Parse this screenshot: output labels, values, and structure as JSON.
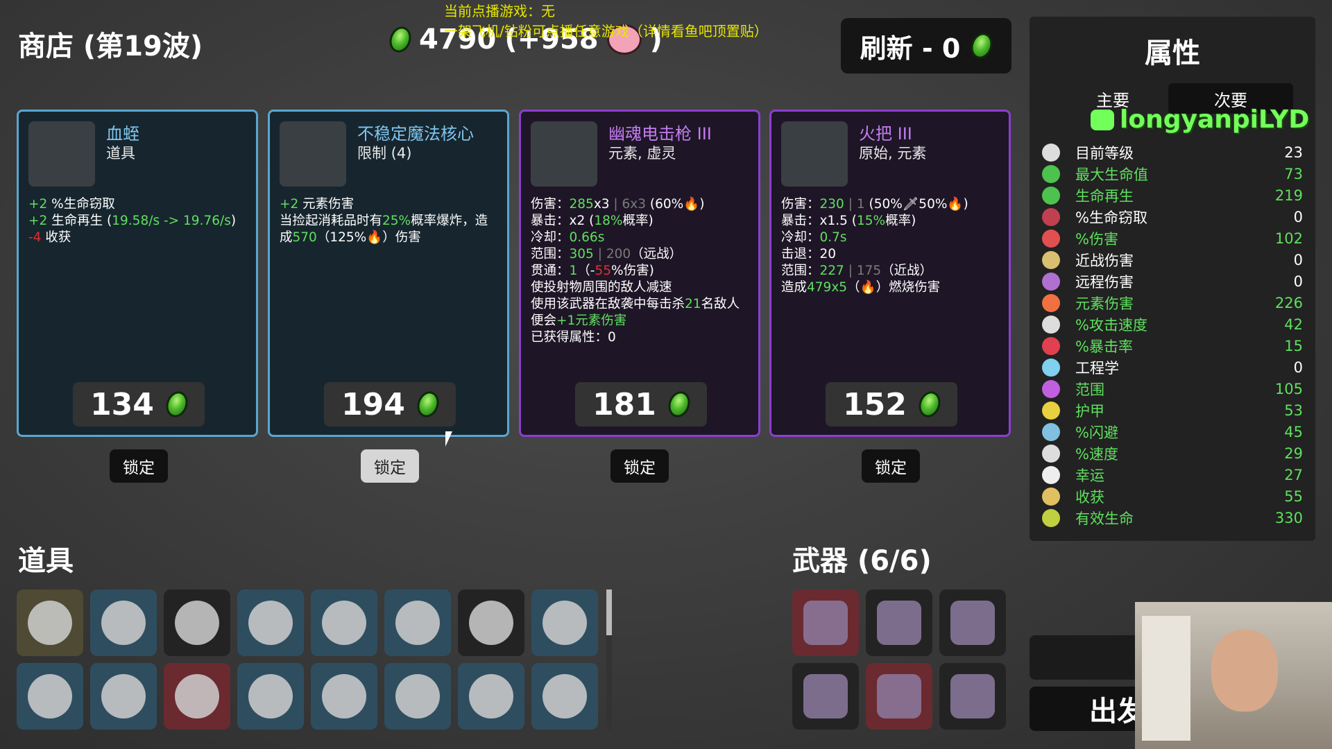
{
  "shop": {
    "title": "商店 (第19波)"
  },
  "money": {
    "amount": "4790",
    "bonus_prefix": "(+958",
    "bonus_suffix": ")"
  },
  "stream_overlay": {
    "line1": "当前点播游戏：无",
    "line2": "一架飞机/钻粉可点播任意游戏（详情看鱼吧顶置贴）"
  },
  "refresh": {
    "label": "刷新 - 0"
  },
  "cards": [
    {
      "name": "血蛭",
      "sub": "道具",
      "price": "134",
      "lock": "锁定",
      "desc_lines": [
        [
          {
            "t": "+2",
            "c": "g"
          },
          {
            "t": " %生命窃取",
            "c": ""
          }
        ],
        [
          {
            "t": "+2",
            "c": "g"
          },
          {
            "t": " 生命再生 (",
            "c": ""
          },
          {
            "t": "19.58/s -> 19.76/s",
            "c": "g"
          },
          {
            "t": ")",
            "c": ""
          }
        ],
        [
          {
            "t": "-4",
            "c": "r"
          },
          {
            "t": " 收获",
            "c": ""
          }
        ]
      ]
    },
    {
      "name": "不稳定魔法核心",
      "sub": "限制 (4)",
      "price": "194",
      "lock": "锁定",
      "desc_lines": [
        [
          {
            "t": "+2",
            "c": "g"
          },
          {
            "t": " 元素伤害",
            "c": ""
          }
        ],
        [
          {
            "t": "当捡起消耗品时有",
            "c": ""
          },
          {
            "t": "25%",
            "c": "g"
          },
          {
            "t": "概率爆炸，造",
            "c": ""
          }
        ],
        [
          {
            "t": "成",
            "c": ""
          },
          {
            "t": "570",
            "c": "g"
          },
          {
            "t": "（125%🔥）伤害",
            "c": ""
          }
        ]
      ]
    },
    {
      "name": "幽魂电击枪 III",
      "sub": "元素, 虚灵",
      "price": "181",
      "lock": "锁定",
      "desc_lines": [
        [
          {
            "t": "伤害：",
            "c": ""
          },
          {
            "t": "285",
            "c": "g"
          },
          {
            "t": "x3",
            "c": ""
          },
          {
            "t": " | 6x3",
            "c": "gr"
          },
          {
            "t": " (60%🔥)",
            "c": ""
          }
        ],
        [
          {
            "t": "暴击：x2 (",
            "c": ""
          },
          {
            "t": "18%",
            "c": "g"
          },
          {
            "t": "概率)",
            "c": ""
          }
        ],
        [
          {
            "t": "冷却：",
            "c": ""
          },
          {
            "t": "0.66s",
            "c": "g"
          }
        ],
        [
          {
            "t": "范围：",
            "c": ""
          },
          {
            "t": "305",
            "c": "g"
          },
          {
            "t": " | 200",
            "c": "gr"
          },
          {
            "t": "（远战）",
            "c": ""
          }
        ],
        [
          {
            "t": "贯通：",
            "c": ""
          },
          {
            "t": "1",
            "c": "g"
          },
          {
            "t": "（-",
            "c": ""
          },
          {
            "t": "55",
            "c": "r"
          },
          {
            "t": "%伤害)",
            "c": ""
          }
        ],
        [
          {
            "t": "使投射物周围的敌人减速",
            "c": ""
          }
        ],
        [
          {
            "t": "使用该武器在敌袭中每击杀",
            "c": ""
          },
          {
            "t": "21",
            "c": "g"
          },
          {
            "t": "名敌人",
            "c": ""
          }
        ],
        [
          {
            "t": "便会",
            "c": ""
          },
          {
            "t": "+1元素伤害",
            "c": "g"
          }
        ],
        [
          {
            "t": "已获得属性：0",
            "c": ""
          }
        ]
      ]
    },
    {
      "name": "火把 III",
      "sub": "原始, 元素",
      "price": "152",
      "lock": "锁定",
      "desc_lines": [
        [
          {
            "t": "伤害：",
            "c": ""
          },
          {
            "t": "230",
            "c": "g"
          },
          {
            "t": " | 1",
            "c": "gr"
          },
          {
            "t": " (50%🗡50%🔥)",
            "c": ""
          }
        ],
        [
          {
            "t": "暴击：x1.5 (",
            "c": ""
          },
          {
            "t": "15%",
            "c": "g"
          },
          {
            "t": "概率)",
            "c": ""
          }
        ],
        [
          {
            "t": "冷却：",
            "c": ""
          },
          {
            "t": "0.7s",
            "c": "g"
          }
        ],
        [
          {
            "t": "击退：20",
            "c": ""
          }
        ],
        [
          {
            "t": "范围：",
            "c": ""
          },
          {
            "t": "227",
            "c": "g"
          },
          {
            "t": " | 175",
            "c": "gr"
          },
          {
            "t": "（近战）",
            "c": ""
          }
        ],
        [
          {
            "t": "造成",
            "c": ""
          },
          {
            "t": "479x5",
            "c": "g"
          },
          {
            "t": "（🔥）燃烧伤害",
            "c": ""
          }
        ]
      ]
    }
  ],
  "items_section": {
    "title": "道具"
  },
  "items": [
    {
      "name": "skull-mask-icon",
      "tone": "olive"
    },
    {
      "name": "rabbit-icon",
      "tone": "blue"
    },
    {
      "name": "red-claw-icon",
      "tone": "dark"
    },
    {
      "name": "snail-icon",
      "tone": "blue"
    },
    {
      "name": "yellow-gem-icon",
      "tone": "blue"
    },
    {
      "name": "bell-hook-icon",
      "tone": "blue"
    },
    {
      "name": "green-fang-icon",
      "tone": "dark"
    },
    {
      "name": "lightning-ring-icon",
      "tone": "blue"
    },
    {
      "name": "red-ring-icon",
      "tone": "blue"
    },
    {
      "name": "black-cloth-icon",
      "tone": "blue"
    },
    {
      "name": "panda-icon",
      "tone": "red"
    },
    {
      "name": "pumpkin-icon",
      "tone": "blue"
    },
    {
      "name": "piggy-bank-icon",
      "tone": "blue"
    },
    {
      "name": "brush-icon",
      "tone": "blue"
    },
    {
      "name": "key-tool-icon",
      "tone": "blue"
    },
    {
      "name": "potion-icon",
      "tone": "blue"
    }
  ],
  "weapons_section": {
    "title": "武器 (6/6)"
  },
  "weapons": [
    {
      "name": "ghost-taser-icon",
      "tone": "red"
    },
    {
      "name": "ghost-taser-icon",
      "tone": "dark"
    },
    {
      "name": "ghost-taser-icon",
      "tone": "dark"
    },
    {
      "name": "ghost-taser-icon",
      "tone": "dark"
    },
    {
      "name": "ghost-taser-icon",
      "tone": "red"
    },
    {
      "name": "ghost-taser-icon",
      "tone": "dark"
    }
  ],
  "stats_panel": {
    "title": "属性",
    "tab_primary": "主要",
    "tab_secondary": "次要",
    "watermark": "longyanpiLYD",
    "rows": [
      {
        "label": "目前等级",
        "value": "23",
        "green": false,
        "icon": "level-icon",
        "color": "#dddddd"
      },
      {
        "label": "最大生命值",
        "value": "73",
        "green": true,
        "icon": "heart-icon",
        "color": "#4ec24e"
      },
      {
        "label": "生命再生",
        "value": "219",
        "green": true,
        "icon": "regen-icon",
        "color": "#4ec24e"
      },
      {
        "label": "%生命窃取",
        "value": "0",
        "green": false,
        "icon": "lifesteal-icon",
        "color": "#c04050"
      },
      {
        "label": "%伤害",
        "value": "102",
        "green": true,
        "icon": "damage-icon",
        "color": "#e05050"
      },
      {
        "label": "近战伤害",
        "value": "0",
        "green": false,
        "icon": "melee-icon",
        "color": "#d8c070"
      },
      {
        "label": "远程伤害",
        "value": "0",
        "green": false,
        "icon": "ranged-icon",
        "color": "#b070d0"
      },
      {
        "label": "元素伤害",
        "value": "226",
        "green": true,
        "icon": "elemental-icon",
        "color": "#f07040"
      },
      {
        "label": "%攻击速度",
        "value": "42",
        "green": true,
        "icon": "attack-speed-icon",
        "color": "#dddddd"
      },
      {
        "label": "%暴击率",
        "value": "15",
        "green": true,
        "icon": "crit-icon",
        "color": "#e04050"
      },
      {
        "label": "工程学",
        "value": "0",
        "green": false,
        "icon": "engineering-icon",
        "color": "#80d0f0"
      },
      {
        "label": "范围",
        "value": "105",
        "green": true,
        "icon": "range-icon",
        "color": "#c060e0"
      },
      {
        "label": "护甲",
        "value": "53",
        "green": true,
        "icon": "armor-icon",
        "color": "#e8d040"
      },
      {
        "label": "%闪避",
        "value": "45",
        "green": true,
        "icon": "dodge-icon",
        "color": "#80c0e0"
      },
      {
        "label": "%速度",
        "value": "29",
        "green": true,
        "icon": "speed-icon",
        "color": "#dddddd"
      },
      {
        "label": "幸运",
        "value": "27",
        "green": true,
        "icon": "luck-icon",
        "color": "#eeeeee"
      },
      {
        "label": "收获",
        "value": "55",
        "green": true,
        "icon": "harvest-icon",
        "color": "#e0c060"
      },
      {
        "label": "有效生命",
        "value": "330",
        "green": true,
        "icon": "effective-hp-icon",
        "color": "#c0d040"
      }
    ]
  },
  "go_button": {
    "label": "出发"
  },
  "colors": {
    "green_text": "#5fe05f",
    "card_blue_border": "#5aa7d0",
    "card_purple_border": "#8b3fd0"
  }
}
